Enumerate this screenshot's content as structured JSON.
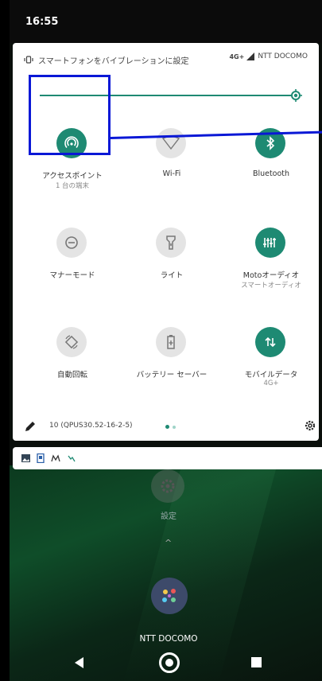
{
  "status": {
    "time": "16:55"
  },
  "header": {
    "vibrate_label": "スマートフォンをバイブレーションに設定",
    "network": "4G+",
    "carrier": "NTT DOCOMO"
  },
  "brightness": {
    "level_fraction": 0.95
  },
  "tiles": [
    {
      "label": "アクセスポイント",
      "sub": "1 台の端末",
      "icon": "hotspot-icon",
      "state": "on"
    },
    {
      "label": "Wi-Fi",
      "sub": "",
      "icon": "wifi-icon",
      "state": "off"
    },
    {
      "label": "Bluetooth",
      "sub": "",
      "icon": "bluetooth-icon",
      "state": "on"
    },
    {
      "label": "マナーモード",
      "sub": "",
      "icon": "do-not-disturb-icon",
      "state": "off"
    },
    {
      "label": "ライト",
      "sub": "",
      "icon": "flashlight-icon",
      "state": "off"
    },
    {
      "label": "Motoオーディオ",
      "sub": "スマートオーディオ",
      "icon": "equalizer-icon",
      "state": "on"
    },
    {
      "label": "自動回転",
      "sub": "",
      "icon": "auto-rotate-icon",
      "state": "off"
    },
    {
      "label": "バッテリー セーバー",
      "sub": "",
      "icon": "battery-saver-icon",
      "state": "off"
    },
    {
      "label": "モバイルデータ",
      "sub": "4G+",
      "icon": "mobile-data-icon",
      "state": "on"
    }
  ],
  "footer": {
    "build": "10 (QPUS30.52-16-2-5)"
  },
  "home": {
    "app_label": "設定",
    "bottom_carrier": "NTT DOCOMO"
  },
  "colors": {
    "accent": "#1e8a73",
    "highlight": "#0a18d6"
  }
}
